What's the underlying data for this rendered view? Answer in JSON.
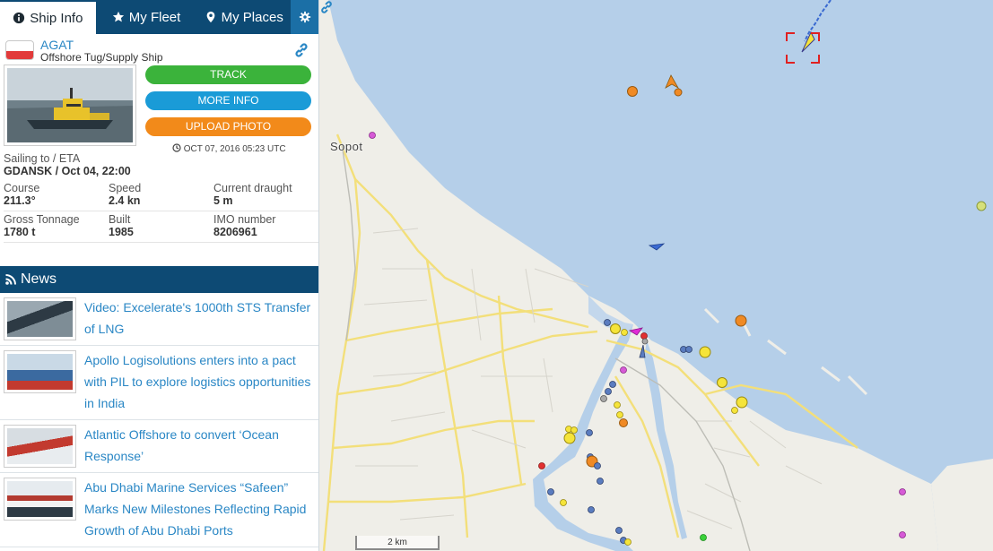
{
  "tabs": {
    "ship_info": "Ship Info",
    "my_fleet": "My Fleet",
    "my_places": "My Places"
  },
  "ship": {
    "name": "AGAT",
    "type": "Offshore Tug/Supply Ship",
    "buttons": {
      "track": "TRACK",
      "more_info": "MORE INFO",
      "upload_photo": "UPLOAD PHOTO"
    },
    "timestamp": "OCT 07, 2016 05:23 UTC",
    "eta_label": "Sailing to / ETA",
    "eta_value": "GDANSK / Oct 04, 22:00",
    "fields": [
      {
        "label": "Course",
        "value": "211.3°"
      },
      {
        "label": "Speed",
        "value": "2.4 kn"
      },
      {
        "label": "Current draught",
        "value": "5 m"
      },
      {
        "label": "Gross Tonnage",
        "value": "1780 t"
      },
      {
        "label": "Built",
        "value": "1985"
      },
      {
        "label": "IMO number",
        "value": "8206961"
      }
    ]
  },
  "news": {
    "header": "News",
    "items": [
      {
        "title": "Video: Excelerate's 1000th STS Transfer of LNG"
      },
      {
        "title": "Apollo Logisolutions enters into a pact with PIL to explore logistics opportunities in India"
      },
      {
        "title": "Atlantic Offshore to convert ‘Ocean Response’"
      },
      {
        "title": "Abu Dhabi Marine Services “Safeen” Marks New Milestones Reflecting Rapid Growth of Abu Dhabi Ports"
      }
    ]
  },
  "map": {
    "place_label": "Sopot",
    "scale_label": "2 km"
  },
  "colors": {
    "nav_blue": "#0d4a74",
    "link_blue": "#2a87c5",
    "track_green": "#3bb33b",
    "more_info_blue": "#1a9bd7",
    "upload_orange": "#f28a1a",
    "sea": "#b5cfe9"
  },
  "icons": {
    "ship_info": "info-circle-icon",
    "my_fleet": "star-icon",
    "my_places": "map-marker-icon",
    "settings": "gear-icon",
    "link": "link-icon",
    "history": "history-icon",
    "news": "rss-icon"
  }
}
